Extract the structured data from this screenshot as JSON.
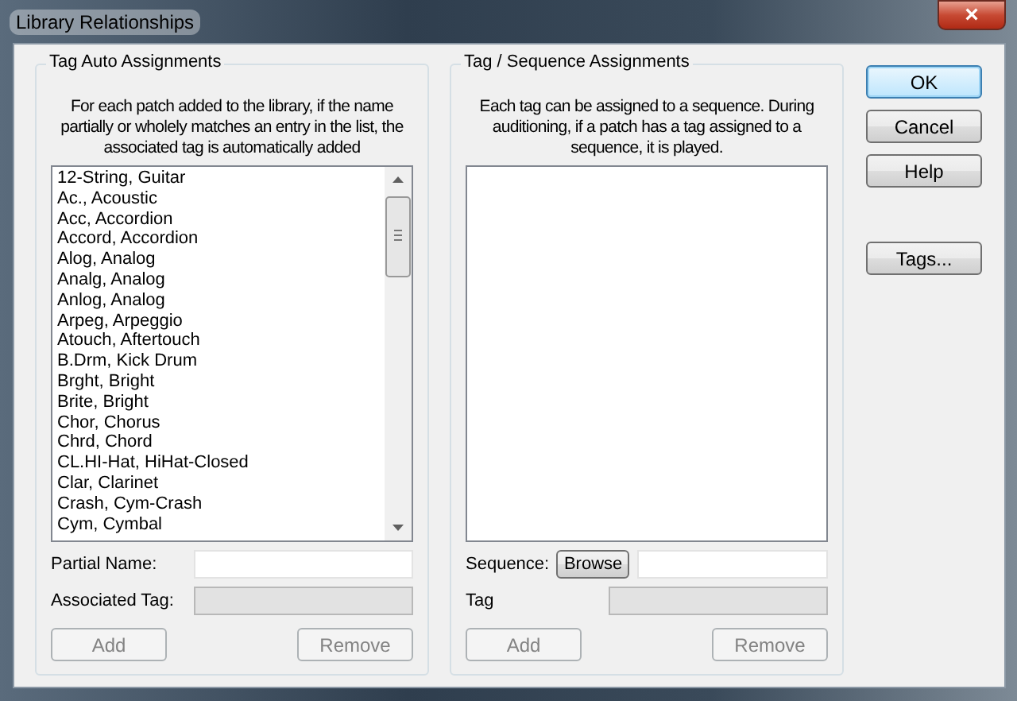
{
  "window": {
    "title": "Library Relationships",
    "close": "×"
  },
  "auto_group": {
    "title": "Tag Auto Assignments",
    "description": "For each patch added to the library, if the name partially or wholely matches an entry in the list, the associated tag is automatically added",
    "list": [
      "12-String, Guitar",
      "Ac., Acoustic",
      "Acc, Accordion",
      "Accord, Accordion",
      "Alog, Analog",
      "Analg, Analog",
      "Anlog, Analog",
      "Arpeg, Arpeggio",
      "Atouch, Aftertouch",
      "B.Drm, Kick Drum",
      "Brght, Bright",
      "Brite, Bright",
      "Chor, Chorus",
      "Chrd, Chord",
      "CL.HI-Hat, HiHat-Closed",
      "Clar, Clarinet",
      "Crash, Cym-Crash",
      "Cym, Cymbal"
    ],
    "fields": [
      {
        "label": "Partial Name:",
        "disabled": false
      },
      {
        "label": "Associated Tag:",
        "disabled": true
      }
    ],
    "buttons": [
      {
        "label": "Add",
        "disabled": true
      },
      {
        "label": "Remove",
        "disabled": true
      }
    ]
  },
  "sequence_group": {
    "title": "Tag / Sequence Assignments",
    "description": "Each tag can be assigned to a sequence. During auditioning, if a patch has a tag assigned to a sequence, it is played.",
    "sequence_label": "Sequence:",
    "browse": "Browse",
    "tag_label": "Tag",
    "tag_disabled": true,
    "buttons": [
      {
        "label": "Add",
        "disabled": true
      },
      {
        "label": "Remove",
        "disabled": true
      }
    ]
  },
  "buttons": [
    {
      "label": "OK",
      "default": true
    },
    {
      "label": "Cancel",
      "default": false
    },
    {
      "label": "Help",
      "default": false
    },
    {
      "label": "Tags...",
      "default": false
    }
  ]
}
